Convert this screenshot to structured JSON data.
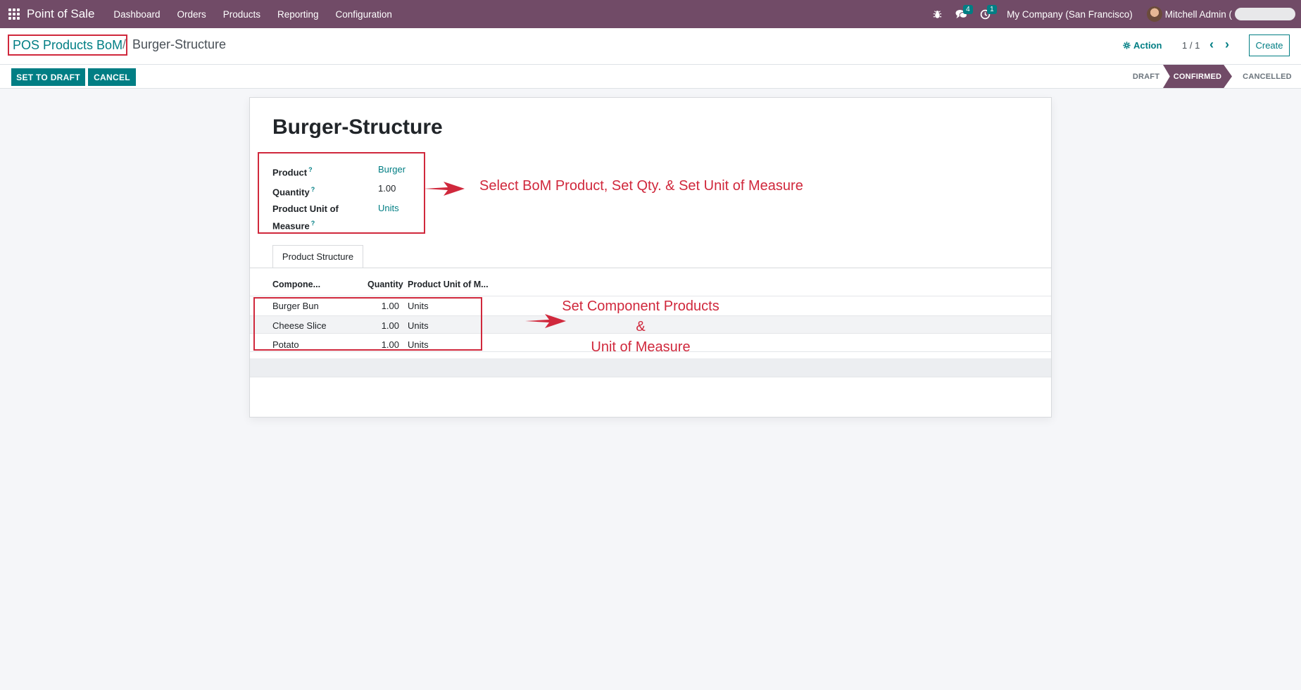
{
  "navbar": {
    "app_name": "Point of Sale",
    "menu": [
      "Dashboard",
      "Orders",
      "Products",
      "Reporting",
      "Configuration"
    ],
    "messages_badge": "4",
    "activities_badge": "1",
    "company": "My Company (San Francisco)",
    "user": "Mitchell Admin ("
  },
  "control": {
    "breadcrumb_parent": "POS Products BoM",
    "breadcrumb_sep": "/",
    "breadcrumb_current": "Burger-Structure",
    "action_label": "Action",
    "pager": "1 / 1",
    "create_label": "Create"
  },
  "status": {
    "buttons": {
      "set_to_draft": "SET TO DRAFT",
      "cancel": "CANCEL"
    },
    "stages": [
      "DRAFT",
      "CONFIRMED",
      "CANCELLED"
    ],
    "active_stage": "CONFIRMED"
  },
  "form": {
    "title": "Burger-Structure",
    "fields": {
      "product_label": "Product",
      "product_value": "Burger",
      "quantity_label": "Quantity",
      "quantity_value": "1.00",
      "uom_label_line1": "Product Unit of",
      "uom_label_line2": "Measure",
      "uom_value": "Units",
      "help_mark": "?"
    },
    "tab": "Product Structure",
    "table": {
      "headers": [
        "Compone...",
        "Quantity",
        "Product Unit of M..."
      ],
      "rows": [
        {
          "component": "Burger Bun",
          "quantity": "1.00",
          "uom": "Units"
        },
        {
          "component": "Cheese Slice",
          "quantity": "1.00",
          "uom": "Units"
        },
        {
          "component": "Potato",
          "quantity": "1.00",
          "uom": "Units"
        }
      ]
    }
  },
  "annotations": {
    "top": "Select BoM Product, Set Qty. & Set Unit of Measure",
    "bottom_line1": "Set Component Products",
    "bottom_line2": "&",
    "bottom_line3": "Unit of Measure"
  },
  "colors": {
    "brand": "#714b67",
    "accent": "#017e84",
    "annotation": "#d0283c"
  }
}
